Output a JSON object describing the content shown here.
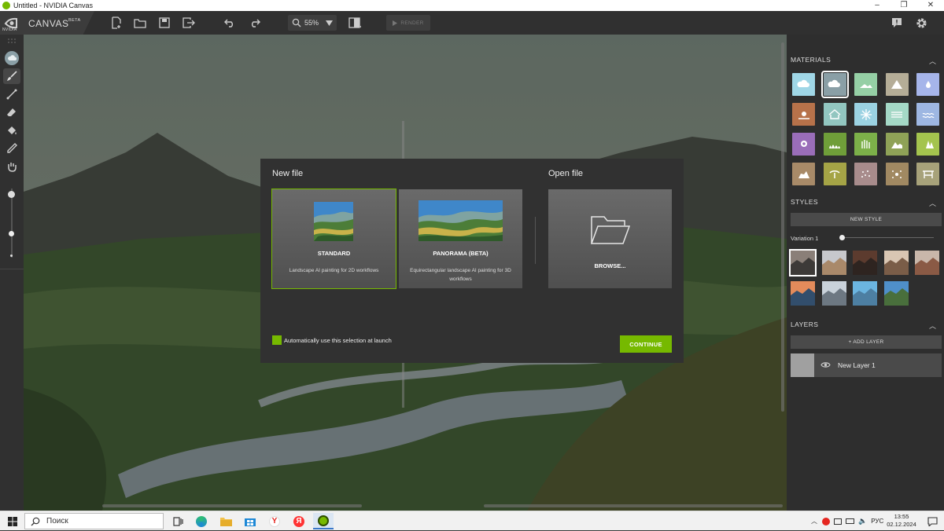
{
  "window": {
    "title": "Untitled - NVIDIA Canvas",
    "controls": [
      "–",
      "❐",
      "✕"
    ]
  },
  "toolbar": {
    "brand_small": "NVIDIA",
    "app_name": "CANVAS",
    "beta_tag": "BETA",
    "zoom": "55%",
    "render_label": "RENDER"
  },
  "right_panel": {
    "materials_title": "MATERIALS",
    "materials": [
      {
        "icon": "cloud-icon",
        "color": "#9fd6e6"
      },
      {
        "icon": "cloud-icon",
        "color": "#8a9fa6"
      },
      {
        "icon": "hill-icon",
        "color": "#95cfa5"
      },
      {
        "icon": "mountain-icon",
        "color": "#b5ad97"
      },
      {
        "icon": "drop-icon",
        "color": "#a6b5ea"
      },
      {
        "icon": "sun-icon",
        "color": "#b7724a"
      },
      {
        "icon": "house-icon",
        "color": "#92c6c0"
      },
      {
        "icon": "snowflake-icon",
        "color": "#9bd2e2"
      },
      {
        "icon": "water-icon",
        "color": "#a4d8c6"
      },
      {
        "icon": "wave-icon",
        "color": "#9eb7e2"
      },
      {
        "icon": "flower-icon",
        "color": "#9a6db9"
      },
      {
        "icon": "grass-icon",
        "color": "#6f9e39"
      },
      {
        "icon": "reed-icon",
        "color": "#7cb049"
      },
      {
        "icon": "bush-icon",
        "color": "#8fa257"
      },
      {
        "icon": "tree-icon",
        "color": "#a4c44e"
      },
      {
        "icon": "rock-icon",
        "color": "#a88a68"
      },
      {
        "icon": "palm-icon",
        "color": "#a5a446"
      },
      {
        "icon": "dirt-icon",
        "color": "#a88c8c"
      },
      {
        "icon": "gravel-icon",
        "color": "#a18962"
      },
      {
        "icon": "bridge-icon",
        "color": "#a7a27a"
      }
    ],
    "styles_title": "STYLES",
    "new_style_label": "NEW STYLE",
    "variation_label": "Variation 1",
    "variation_value": 0,
    "style_thumbs": [
      {
        "sky": "#8a7f78",
        "land": "#3d3a38"
      },
      {
        "sky": "#c7c8cc",
        "land": "#a9896a"
      },
      {
        "sky": "#5c3b2e",
        "land": "#2e2420"
      },
      {
        "sky": "#d9c6b3",
        "land": "#7a5d48"
      },
      {
        "sky": "#c9b7aa",
        "land": "#8a5a45"
      },
      {
        "sky": "#e38b5b",
        "land": "#324e6c"
      },
      {
        "sky": "#c9d2da",
        "land": "#6d7882"
      },
      {
        "sky": "#6bb5e0",
        "land": "#4d7fa2"
      },
      {
        "sky": "#4f8fc9",
        "land": "#496f3c"
      }
    ],
    "layers_title": "LAYERS",
    "add_layer_label": "+ ADD LAYER",
    "layer_name": "New Layer 1"
  },
  "dialog": {
    "new_file_title": "New file",
    "open_file_title": "Open file",
    "standard_title": "STANDARD",
    "standard_desc": "Landscape AI painting for 2D workflows",
    "panorama_title": "PANORAMA (BETA)",
    "panorama_desc": "Equirectangular landscape AI painting for 3D workflows",
    "browse_label": "BROWSE...",
    "auto_label": "Automatically use this selection at launch",
    "continue_label": "CONTINUE"
  },
  "taskbar": {
    "search_placeholder": "Поиск",
    "language": "РУС",
    "time": "13:55",
    "date": "02.12.2024"
  }
}
